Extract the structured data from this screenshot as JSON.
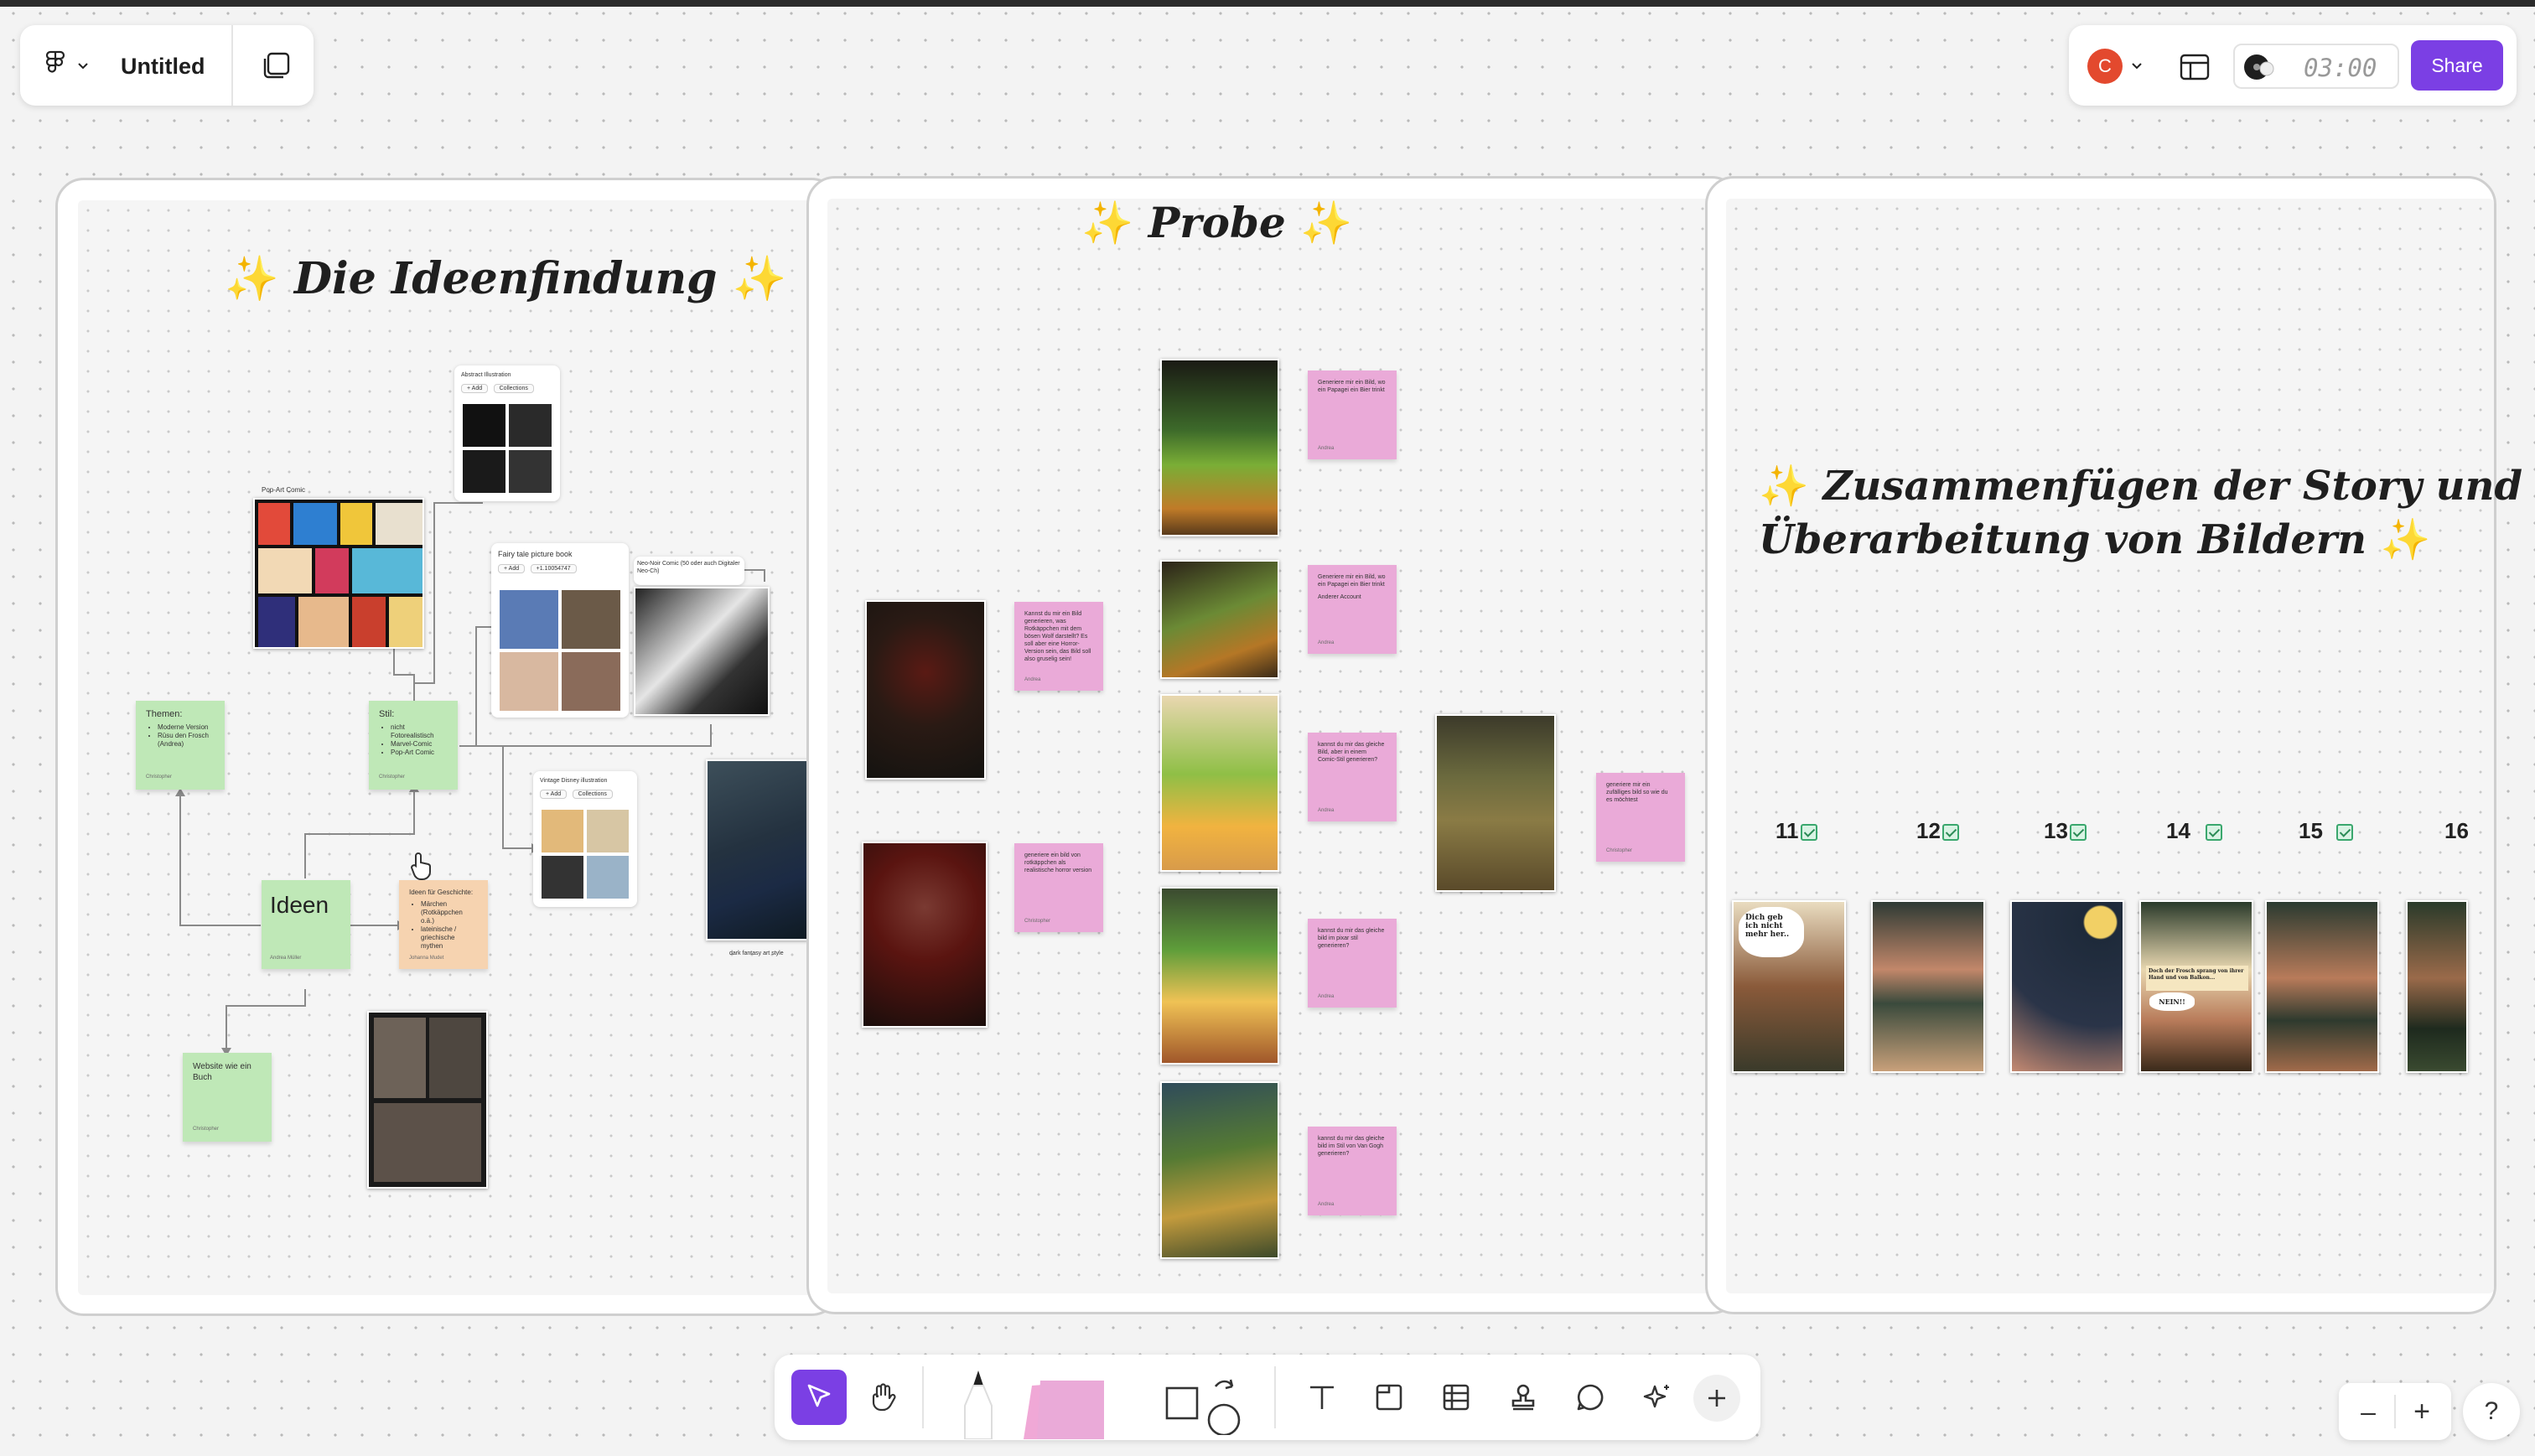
{
  "header": {
    "title": "Untitled",
    "avatar_letter": "C",
    "timer": "03:00",
    "share_label": "Share"
  },
  "sections": {
    "ideen": {
      "title": "Die Ideenfindung",
      "themen_title": "Themen:",
      "themen_items": [
        "Moderne Version",
        "Rūsu den Frosch",
        "(Andrea)"
      ],
      "themen_author": "Christopher",
      "stil_title": "Stil:",
      "stil_items": [
        "nicht Fotorealistisch",
        "Marvel-Comic",
        "Pop-Art Comic"
      ],
      "stil_author": "Christopher",
      "ideen_label": "Ideen",
      "ideen_author": "Andrea Müller",
      "website_text": "Website wie ein Buch",
      "website_author": "Christopher",
      "geschichte_title": "Ideen für Geschichte:",
      "geschichte_items": [
        "Märchen (Rotkäppchen o.ä.)",
        "lateinische / griechische mythen"
      ],
      "geschichte_author": "Johanna Mudet",
      "pop_art_label": "Pop-Art Comic",
      "abstract_title": "Abstract Illustration",
      "abstract_chip1": "+ Add",
      "abstract_chip2": "Collections",
      "fairy_title": "Fairy tale picture book",
      "fairy_chip1": "+ Add",
      "fairy_chip2": "+1.10054747",
      "noir_label": "Neo-Noir Comic (50 oder auch Digitaler Neo-Ch)",
      "disney_title": "Vintage Disney illustration",
      "disney_chip1": "+ Add",
      "disney_chip2": "Collections",
      "fantasy_label": "dark fantasy art style"
    },
    "probe": {
      "title": "Probe",
      "notes": [
        {
          "text": "Generiere mir ein Bild, wo ein Papagei ein Bier trinkt",
          "author": "Andrea"
        },
        {
          "text": "Generiere mir ein Bild, wo ein Papagei ein Bier trinkt",
          "extra": "Anderer Account",
          "author": "Andrea"
        },
        {
          "text": "kannst du mir das gleiche Bild, aber in einem Comic-Stil generieren?",
          "author": "Andrea"
        },
        {
          "text": "kannst du mir das gleiche bild im pixar stil generieren?",
          "author": "Andrea"
        },
        {
          "text": "kannst du mir das gleiche bild im Stil von Van Gogh generieren?",
          "author": "Andrea"
        },
        {
          "text": "Kannst du mir ein Bild generieren, was Rotkäppchen mit dem bösen Wolf darstellt? Es soll aber eine Horror-Version sein, das Bild soll also gruselig sein!",
          "author": "Andrea"
        },
        {
          "text": "generiere ein bild von rotkäppchen als realistische horror version",
          "author": "Christopher"
        },
        {
          "text": "generiere mir ein zufälliges bild so wie du es möchtest",
          "author": "Christopher"
        }
      ]
    },
    "story": {
      "title_line1": "Zusammenfügen der Story und",
      "title_line2": "Überarbeitung von Bildern",
      "page_numbers": [
        "11",
        "12",
        "13",
        "14",
        "15",
        "16"
      ],
      "bubble1": "Dich geb ich nicht mehr her..",
      "bubble2": "Doch der Frosch sprang von ihrer Hand und von Balkon...",
      "bubble3": "NEIN!!"
    }
  },
  "toolbar": {
    "tools": [
      "select-tool",
      "hand-tool",
      "marker-tool",
      "sticky-note-tool",
      "shape-tool",
      "text-tool",
      "section-tool",
      "table-tool",
      "stamp-tool",
      "comment-tool",
      "ai-tool",
      "more-tool"
    ]
  },
  "zoom_controls": {
    "minus": "–",
    "plus": "+",
    "help": "?"
  },
  "colors": {
    "accent": "#7b3fe4",
    "sticky_green": "#bfe8b7",
    "sticky_pink": "#eaaad8",
    "sticky_peach": "#f6d3b0",
    "avatar": "#e3492e"
  }
}
